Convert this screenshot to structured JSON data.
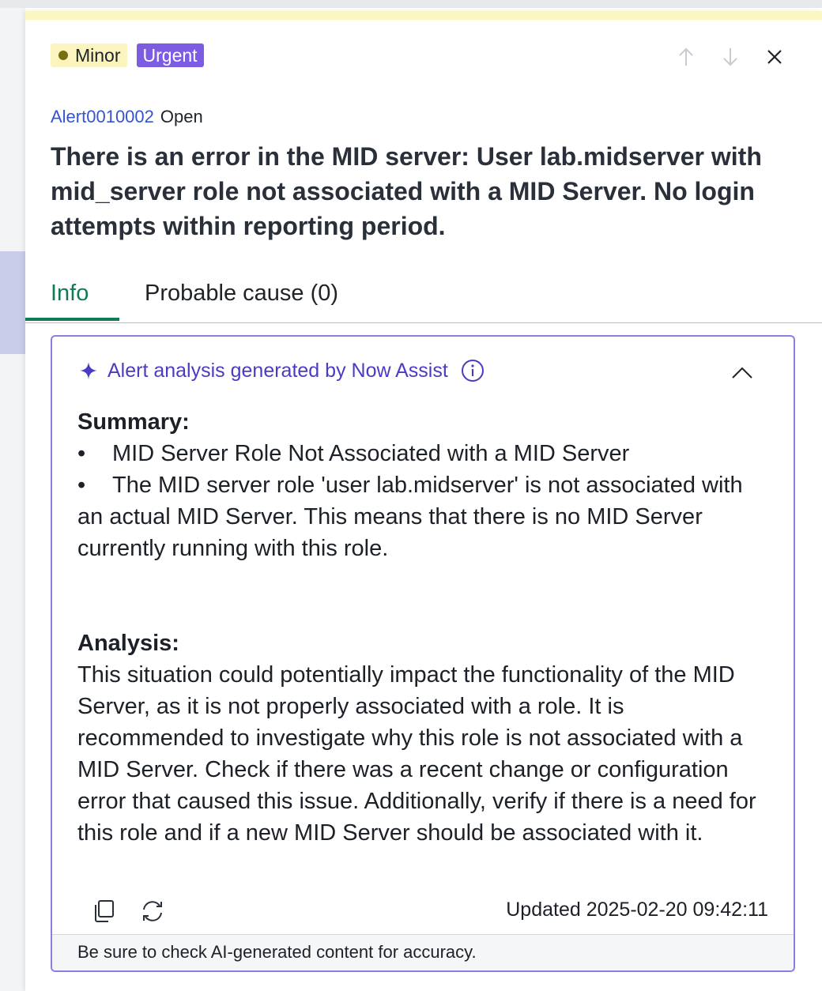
{
  "badges": {
    "severity": "Minor",
    "priority": "Urgent"
  },
  "nav": {
    "prev_icon": "arrow-up-icon",
    "next_icon": "arrow-down-icon",
    "close_icon": "close-icon"
  },
  "alert": {
    "id": "Alert0010002",
    "status": "Open",
    "title": "There is an error in the MID server: User lab.midserver with mid_server role not associated with a MID Server. No login attempts within reporting period."
  },
  "tabs": [
    {
      "label": "Info",
      "active": true
    },
    {
      "label": "Probable cause (0)",
      "active": false
    }
  ],
  "analysis_card": {
    "header": "Alert analysis generated by Now Assist",
    "summary_heading": "Summary:",
    "summary_items": [
      "MID Server Role Not Associated with a MID Server",
      "The MID server role 'user lab.midserver' is not associated with an actual MID Server. This means that there is no MID Server currently running with this role."
    ],
    "analysis_heading": "Analysis:",
    "analysis_text": "This situation could potentially impact the functionality of the MID Server, as it is not properly associated with a role. It is recommended to investigate why this role is not associated with a MID Server. Check if there was a recent change or configuration error that caused this issue. Additionally, verify if there is a need for this role and if a new MID Server should be associated with it.",
    "updated": "Updated 2025-02-20 09:42:11",
    "disclaimer": "Be sure to check AI-generated content for accuracy."
  },
  "colors": {
    "accent_purple": "#7b5ce2",
    "link_blue": "#3554d1",
    "tab_active_green": "#127a54",
    "minor_badge_bg": "#fbf4bf"
  }
}
